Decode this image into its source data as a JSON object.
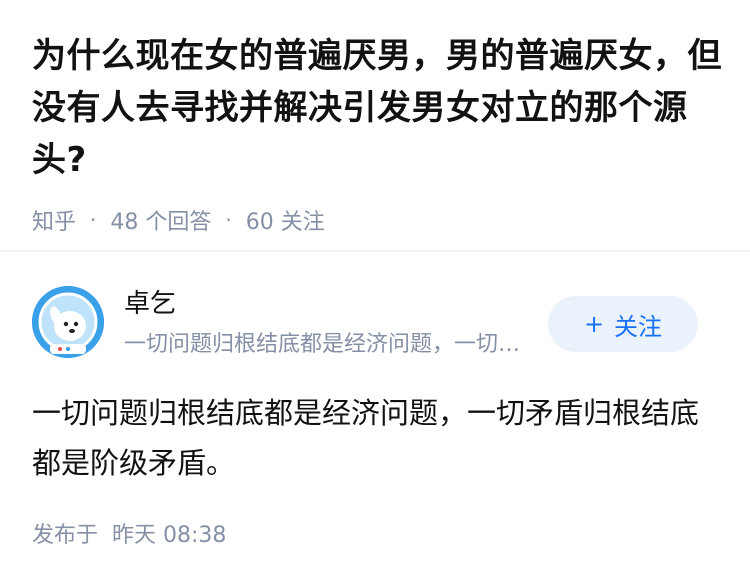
{
  "question": {
    "title": "为什么现在女的普遍厌男，男的普遍厌女，但没有人去寻找并解决引发男女对立的那个源头?",
    "source": "知乎",
    "answer_count": "48 个回答",
    "follow_count": "60 关注"
  },
  "answer": {
    "author": {
      "name": "卓乞",
      "bio": "一切问题归根结底都是经济问题，一切矛盾归根结底都是阶级矛盾。",
      "follow_label": "关注"
    },
    "content": "一切问题归根结底都是经济问题，一切矛盾归根结底都是阶级矛盾。",
    "published": "发布于  昨天 08:38"
  },
  "colors": {
    "accent": "#1772f6",
    "follow_bg": "#eaf2fc",
    "meta": "#8590a6",
    "text": "#121212"
  }
}
